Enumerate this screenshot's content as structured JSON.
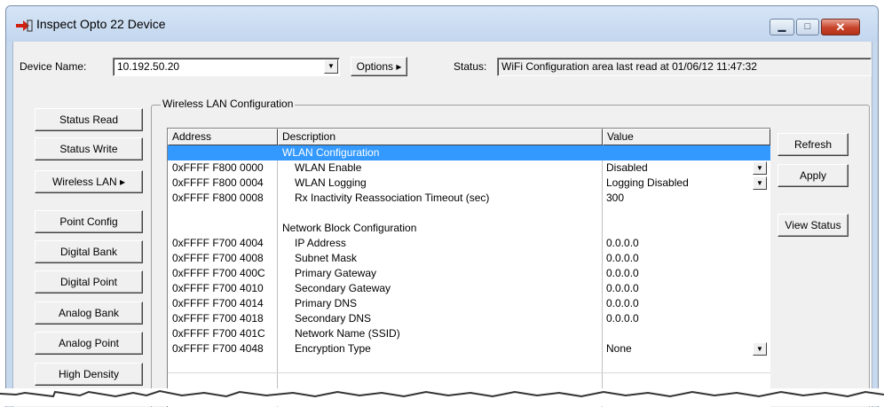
{
  "window": {
    "title": "Inspect Opto 22 Device"
  },
  "top": {
    "device_label": "Device Name:",
    "device_value": "10.192.50.20",
    "options_label": "Options ▸",
    "status_label": "Status:",
    "status_value": "WiFi Configuration area last read at 01/06/12 11:47:32"
  },
  "left_buttons": [
    "Status Read",
    "Status Write",
    "Wireless LAN ▸",
    "Point Config",
    "Digital Bank",
    "Digital Point",
    "Analog Bank",
    "Analog Point",
    "High Density"
  ],
  "group": {
    "caption": "Wireless LAN Configuration"
  },
  "table": {
    "columns": [
      "Address",
      "Description",
      "Value"
    ],
    "rows": [
      {
        "address": "",
        "description": "WLAN Configuration",
        "value": "",
        "selected": true
      },
      {
        "address": "0xFFFF F800 0000",
        "description": "WLAN Enable",
        "value": "Disabled",
        "dropdown": true
      },
      {
        "address": "0xFFFF F800 0004",
        "description": "WLAN Logging",
        "value": "Logging Disabled",
        "dropdown": true
      },
      {
        "address": "0xFFFF F800 0008",
        "description": "Rx Inactivity Reassociation Timeout (sec)",
        "value": "300"
      },
      {
        "address": "",
        "description": "",
        "value": ""
      },
      {
        "address": "",
        "description": "Network Block Configuration",
        "value": "",
        "heading": true
      },
      {
        "address": "0xFFFF F700 4004",
        "description": "IP Address",
        "value": "0.0.0.0"
      },
      {
        "address": "0xFFFF F700 4008",
        "description": "Subnet Mask",
        "value": "0.0.0.0"
      },
      {
        "address": "0xFFFF F700 400C",
        "description": "Primary Gateway",
        "value": "0.0.0.0"
      },
      {
        "address": "0xFFFF F700 4010",
        "description": "Secondary Gateway",
        "value": "0.0.0.0"
      },
      {
        "address": "0xFFFF F700 4014",
        "description": "Primary DNS",
        "value": "0.0.0.0"
      },
      {
        "address": "0xFFFF F700 4018",
        "description": "Secondary DNS",
        "value": "0.0.0.0"
      },
      {
        "address": "0xFFFF F700 401C",
        "description": "Network Name (SSID)",
        "value": ""
      },
      {
        "address": "0xFFFF F700 4048",
        "description": "Encryption Type",
        "value": "None",
        "dropdown": true
      }
    ]
  },
  "right_buttons": {
    "refresh": "Refresh",
    "apply": "Apply",
    "view_status": "View Status"
  }
}
